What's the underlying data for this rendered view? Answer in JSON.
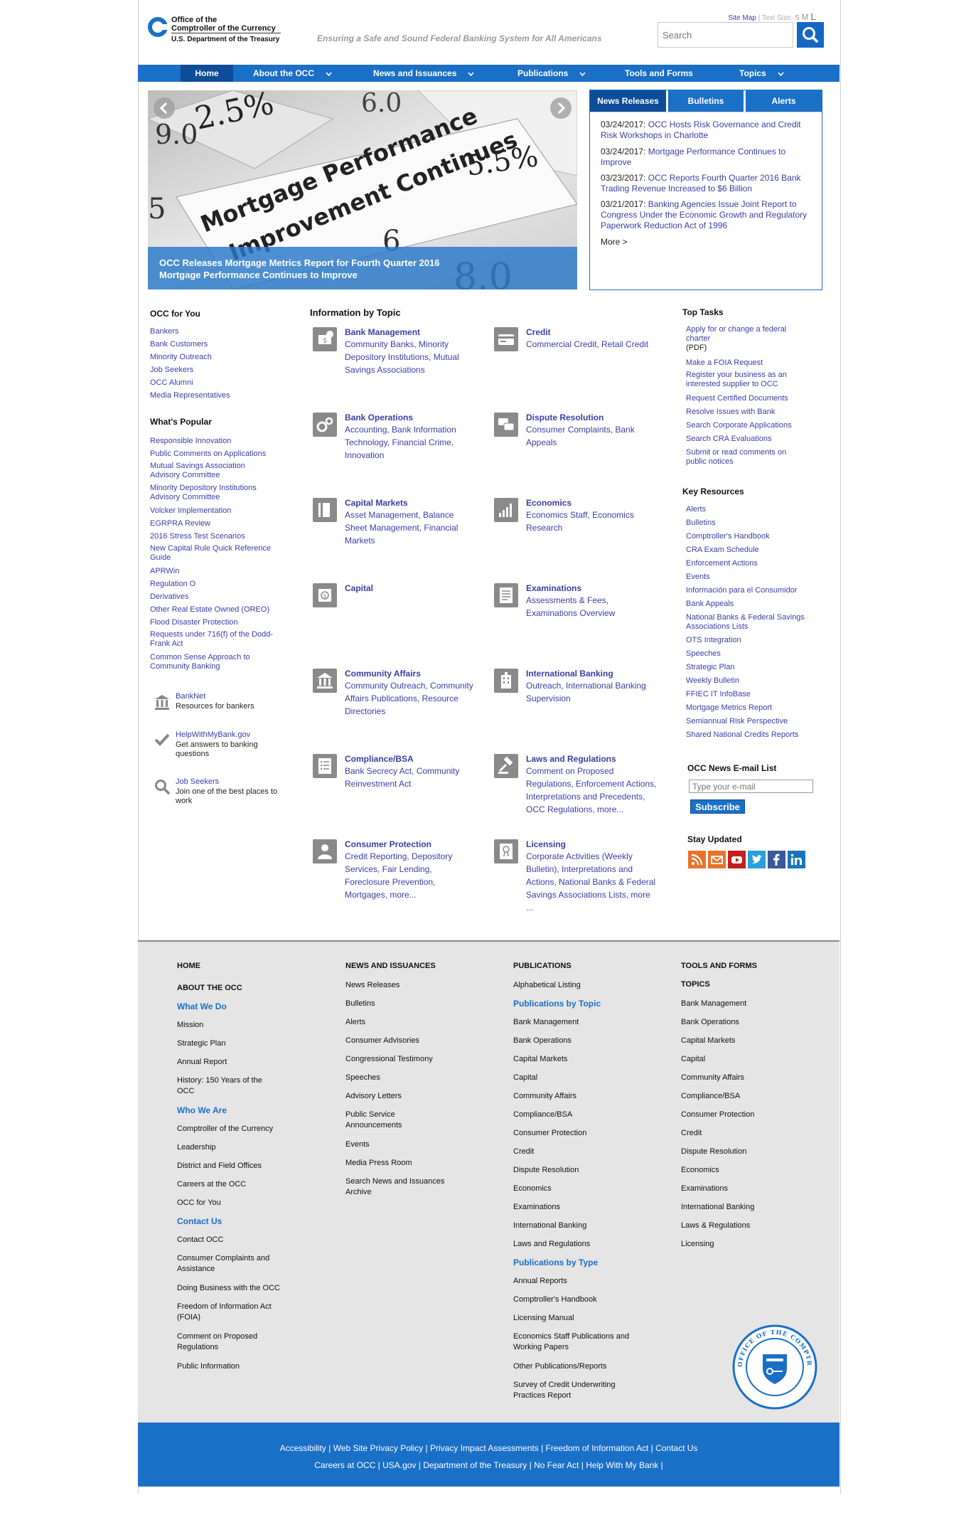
{
  "header": {
    "logo_lines": [
      "Office of the",
      "Comptroller of the Currency",
      "U.S. Department of the Treasury"
    ],
    "tagline": "Ensuring a Safe and Sound Federal Banking System for All Americans",
    "utility": {
      "site_map": "Site Map",
      "separator": " | ",
      "text_size": "Text Size:",
      "sizes": [
        "S",
        "M",
        "L"
      ]
    },
    "search_placeholder": "Search",
    "brand_color": "#1a6fc7"
  },
  "nav": {
    "items": [
      {
        "label": "Home",
        "has_menu": false
      },
      {
        "label": "About the OCC",
        "has_menu": true
      },
      {
        "label": "News and Issuances",
        "has_menu": true
      },
      {
        "label": "Publications",
        "has_menu": true
      },
      {
        "label": "Tools and Forms",
        "has_menu": false
      },
      {
        "label": "Topics",
        "has_menu": true
      }
    ]
  },
  "hero": {
    "caption_line1": "OCC Releases Mortgage Metrics Report for Fourth Quarter 2016",
    "caption_line2": "Mortgage Performance Continues to Improve",
    "image_text": "Mortgage Performance Improvement Continues"
  },
  "news": {
    "tabs": [
      "News Releases",
      "Bulletins",
      "Alerts"
    ],
    "items": [
      {
        "date": "03/24/2017:",
        "title": "OCC Hosts Risk Governance and Credit Risk Workshops in Charlotte"
      },
      {
        "date": "03/24/2017:",
        "title": "Mortgage Performance Continues to Improve"
      },
      {
        "date": "03/23/2017:",
        "title": "OCC Reports Fourth Quarter 2016 Bank Trading Revenue Increased to $6 Billion"
      },
      {
        "date": "03/21/2017:",
        "title": "Banking Agencies Issue Joint Report to Congress Under the Economic Growth and Regulatory Paperwork Reduction Act of 1996"
      }
    ],
    "more": "More >"
  },
  "occ_for_you": {
    "heading": "OCC for You",
    "links": [
      "Bankers",
      "Bank Customers",
      "Minority Outreach",
      "Job Seekers",
      "OCC Alumni",
      "Media Representatives"
    ]
  },
  "popular": {
    "heading": "What's Popular",
    "links": [
      "Responsible Innovation",
      "Public Comments on Applications",
      "Mutual Savings Association Advisory Committee",
      "Minority Depository Institutions Advisory Committee",
      "Volcker Implementation",
      "EGRPRA Review",
      "2016 Stress Test Scenarios",
      "New Capital Rule Quick Reference Guide",
      "APRWin",
      "Regulation O",
      "Derivatives",
      "Other Real Estate Owned (OREO)",
      "Flood Disaster Protection",
      "Requests under 716(f) of the Dodd-Frank Act",
      "Common Sense Approach to Community Banking"
    ]
  },
  "promos": [
    {
      "title": "BankNet",
      "desc": "Resources for bankers",
      "icon": "bank-icon"
    },
    {
      "title": "HelpWithMyBank.gov",
      "desc": "Get answers to banking questions",
      "icon": "checkmark-icon"
    },
    {
      "title": "Job Seekers",
      "desc": "Join one of the best places to work",
      "icon": "magnifier-icon"
    }
  ],
  "topics": {
    "heading": "Information by Topic",
    "items": [
      {
        "title": "Bank Management",
        "desc": "Community Banks, Minority Depository Institutions, Mutual Savings Associations"
      },
      {
        "title": "Credit",
        "desc": "Commercial Credit, Retail Credit"
      },
      {
        "title": "Bank Operations",
        "desc": "Accounting, Bank Information Technology, Financial Crime, Innovation"
      },
      {
        "title": "Dispute Resolution",
        "desc": "Consumer Complaints, Bank Appeals"
      },
      {
        "title": "Capital Markets",
        "desc": "Asset Management, Balance Sheet Management, Financial Markets"
      },
      {
        "title": "Economics",
        "desc": "Economics Staff, Economics Research"
      },
      {
        "title": "Capital",
        "desc": ""
      },
      {
        "title": "Examinations",
        "desc": "Assessments & Fees, Examinations Overview"
      },
      {
        "title": "Community Affairs",
        "desc": "Community Outreach, Community Affairs Publications, Resource Directories"
      },
      {
        "title": "International Banking",
        "desc": "Outreach, International Banking Supervision"
      },
      {
        "title": "Compliance/BSA",
        "desc": "Bank Secrecy Act, Community Reinvestment Act"
      },
      {
        "title": "Laws and Regulations",
        "desc": "Comment on Proposed Regulations, Enforcement Actions, Interpretations and Precedents, OCC Regulations, more..."
      },
      {
        "title": "Consumer Protection",
        "desc": "Credit Reporting, Depository Services, Fair Lending, Foreclosure Prevention, Mortgages, more..."
      },
      {
        "title": "Licensing",
        "desc": "Corporate Activities (Weekly Bulletin), Interpretations and Actions, National Banks & Federal Savings Associations Lists, more ..."
      }
    ]
  },
  "top_tasks": {
    "heading": "Top Tasks",
    "items": [
      {
        "text": "Apply for or change a federal charter",
        "suffix": "(PDF)"
      },
      {
        "text": "Make a FOIA Request",
        "suffix": ""
      },
      {
        "text": "Register your business as an interested supplier to OCC",
        "suffix": ""
      },
      {
        "text": "Request Certified Documents",
        "suffix": ""
      },
      {
        "text": "Resolve Issues with Bank",
        "suffix": ""
      },
      {
        "text": "Search Corporate Applications",
        "suffix": ""
      },
      {
        "text": "Search CRA Evaluations",
        "suffix": ""
      },
      {
        "text": "Submit or read comments on public notices",
        "suffix": ""
      }
    ]
  },
  "key_resources": {
    "heading": "Key Resources",
    "links": [
      "Alerts",
      "Bulletins",
      "Comptroller's Handbook",
      "CRA Exam Schedule",
      "Enforcement Actions",
      "Events",
      "Información para el Consumidor",
      "Bank Appeals",
      "National Banks & Federal Savings Associations Lists",
      "OTS Integration",
      "Speeches",
      "Strategic Plan",
      "Weekly Bulletin",
      "FFIEC IT InfoBase",
      "Mortgage Metrics Report",
      "Semiannual Risk Perspective",
      "Shared National Credits Reports"
    ]
  },
  "email_list": {
    "heading": "OCC News E-mail List",
    "placeholder": "Type your e-mail",
    "button": "Subscribe"
  },
  "stay_updated": {
    "heading": "Stay Updated",
    "icons": [
      "rss-icon",
      "email-icon",
      "youtube-icon",
      "twitter-icon",
      "facebook-icon",
      "linkedin-icon"
    ]
  },
  "footer": {
    "col1": {
      "home": "HOME",
      "about": "ABOUT THE OCC",
      "groups": [
        {
          "sub": "What We Do",
          "links": [
            "Mission",
            "Strategic Plan",
            "Annual Report",
            "History: 150 Years of the OCC"
          ]
        },
        {
          "sub": "Who We Are",
          "links": [
            "Comptroller of the Currency",
            "Leadership",
            "District and Field Offices",
            "Careers at the OCC",
            "OCC for You"
          ]
        },
        {
          "sub": "Contact Us",
          "links": [
            "Contact OCC",
            "Consumer Complaints and Assistance",
            "Doing Business with the OCC",
            "Freedom of Information Act (FOIA)",
            "Comment on Proposed Regulations",
            "Public Information"
          ]
        }
      ]
    },
    "col2": {
      "heading": "NEWS AND ISSUANCES",
      "links": [
        "News Releases",
        "Bulletins",
        "Alerts",
        "Consumer Advisories",
        "Congressional Testimony",
        "Speeches",
        "Advisory Letters",
        "Public Service Announcements",
        "Events",
        "Media Press Room",
        "Search News and Issuances Archive"
      ]
    },
    "col3": {
      "heading": "PUBLICATIONS",
      "first": "Alphabetical Listing",
      "sub1": "Publications by Topic",
      "topic_links": [
        "Bank Management",
        "Bank Operations",
        "Capital Markets",
        "Capital",
        "Community Affairs",
        "Compliance/BSA",
        "Consumer Protection",
        "Credit",
        "Dispute Resolution",
        "Economics",
        "Examinations",
        "International Banking",
        "Laws and Regulations"
      ],
      "sub2": "Publications by Type",
      "type_links": [
        "Annual Reports",
        "Comptroller's Handbook",
        "Licensing Manual",
        "Economics Staff Publications and Working Papers",
        "Other Publications/Reports",
        "Survey of Credit Underwriting Practices Report"
      ]
    },
    "col4": {
      "heading": "TOOLS AND FORMS",
      "topics_heading": "TOPICS",
      "links": [
        "Bank Management",
        "Bank Operations",
        "Capital Markets",
        "Capital",
        "Community Affairs",
        "Compliance/BSA",
        "Consumer Protection",
        "Credit",
        "Dispute Resolution",
        "Economics",
        "Examinations",
        "International Banking",
        "Laws & Regulations",
        "Licensing"
      ]
    },
    "seal_text": "OFFICE OF THE COMPTROLLER OF THE CURRENCY"
  },
  "bottom_bar": {
    "line1": [
      "Accessibility",
      "Web Site Privacy Policy",
      "Privacy Impact Assessments",
      "Freedom of Information Act",
      "Contact Us"
    ],
    "line2": [
      "Careers at OCC",
      "USA.gov",
      "Department of the Treasury",
      "No Fear Act",
      "Help With My Bank"
    ],
    "separator": " | "
  }
}
